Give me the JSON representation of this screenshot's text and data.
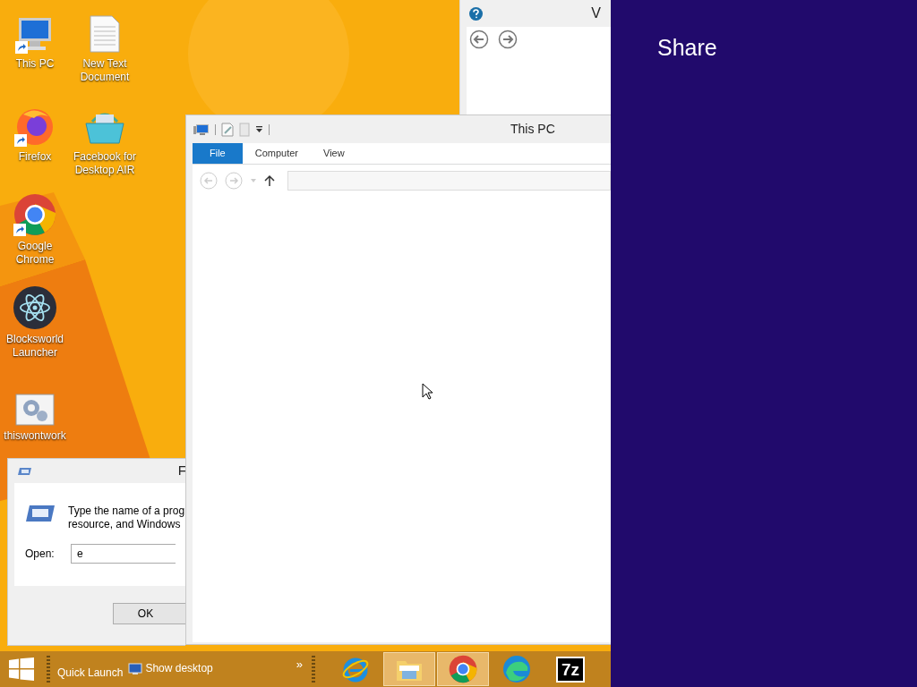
{
  "desktop": {
    "icons": [
      {
        "label": "This PC",
        "kind": "computer",
        "shortcut": true
      },
      {
        "label": "New Text Document",
        "kind": "text",
        "shortcut": false
      },
      {
        "label": "Firefox",
        "kind": "firefox",
        "shortcut": true
      },
      {
        "label": "Facebook for Desktop AIR",
        "kind": "basket",
        "shortcut": false
      },
      {
        "label": "Google Chrome",
        "kind": "chrome",
        "shortcut": true
      },
      {
        "label": "Blocksworld Launcher",
        "kind": "atom",
        "shortcut": false
      },
      {
        "label": "thiswontwork",
        "kind": "gear",
        "shortcut": false
      }
    ]
  },
  "help_window": {
    "title": "V"
  },
  "explorer": {
    "title": "This PC",
    "ribbon_tabs": [
      {
        "label": "File",
        "selected": true
      },
      {
        "label": "Computer",
        "selected": false
      },
      {
        "label": "View",
        "selected": false
      }
    ]
  },
  "run_dialog": {
    "title": "F",
    "description_lines": [
      "Type the name of a prog",
      "resource, and Windows"
    ],
    "open_label": "Open:",
    "value": "e",
    "ok_button": "OK"
  },
  "taskbar": {
    "quick_launch": "Quick Launch",
    "show_desktop": "Show desktop",
    "overflow": "»",
    "apps": [
      {
        "kind": "ie",
        "active": false
      },
      {
        "kind": "explorer",
        "active": true
      },
      {
        "kind": "chrome",
        "active": true
      },
      {
        "kind": "edge",
        "active": false
      },
      {
        "kind": "archiver",
        "label": "7z",
        "active": false
      }
    ]
  },
  "charm": {
    "title": "Share"
  }
}
